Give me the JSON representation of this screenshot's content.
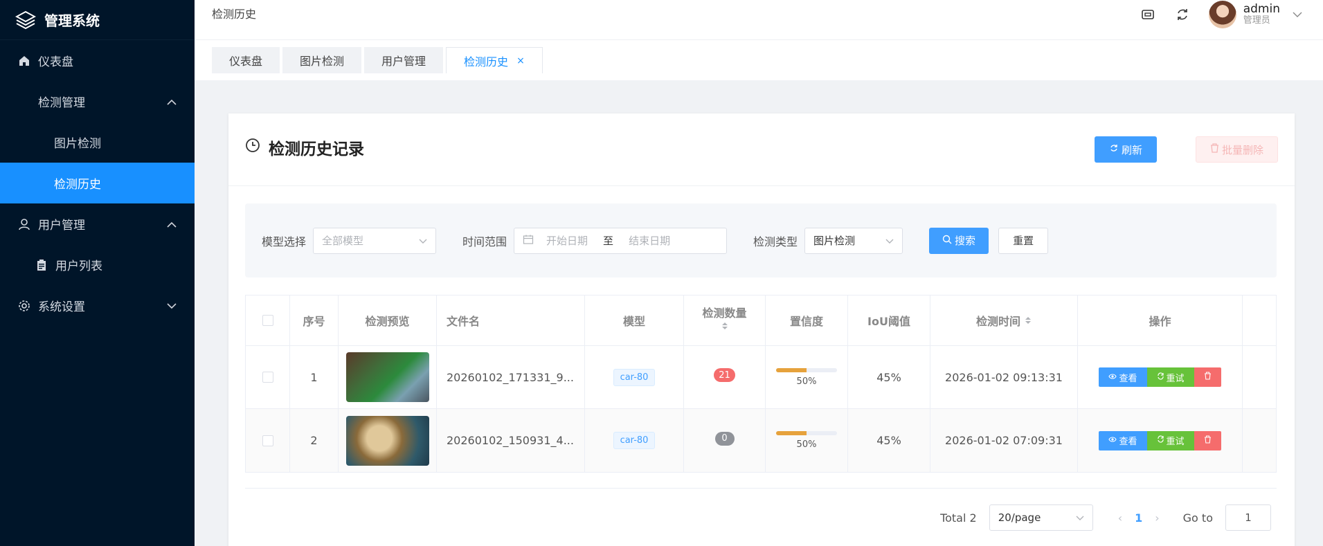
{
  "app": {
    "title": "管理系统"
  },
  "sidebar": {
    "items": [
      {
        "label": "仪表盘",
        "icon": "home-icon"
      },
      {
        "label": "检测管理",
        "icon": "",
        "expanded": true
      },
      {
        "label": "图片检测"
      },
      {
        "label": "检测历史",
        "active": true
      },
      {
        "label": "用户管理",
        "icon": "user-icon",
        "expanded": true
      },
      {
        "label": "用户列表",
        "icon": "clipboard-icon"
      },
      {
        "label": "系统设置",
        "icon": "gear-icon",
        "expanded": false
      }
    ]
  },
  "header": {
    "breadcrumb": "检测历史",
    "user": {
      "name": "admin",
      "role": "管理员"
    }
  },
  "tabs": [
    {
      "label": "仪表盘"
    },
    {
      "label": "图片检测"
    },
    {
      "label": "用户管理"
    },
    {
      "label": "检测历史",
      "active": true,
      "close": "×"
    }
  ],
  "card": {
    "title": "检测历史记录",
    "refresh_label": "刷新",
    "batch_delete_label": "批量删除"
  },
  "filter": {
    "model_label": "模型选择",
    "model_placeholder": "全部模型",
    "time_label": "时间范围",
    "start_placeholder": "开始日期",
    "range_sep": "至",
    "end_placeholder": "结束日期",
    "type_label": "检测类型",
    "type_value": "图片检测",
    "search_label": "搜索",
    "reset_label": "重置"
  },
  "table": {
    "columns": [
      "序号",
      "检测预览",
      "文件名",
      "模型",
      "检测数量",
      "置信度",
      "IoU阈值",
      "检测时间",
      "操作"
    ],
    "rows": [
      {
        "idx": "1",
        "file": "20260102_171331_9...",
        "model": "car-80",
        "count": "21",
        "conf": "50%",
        "conf_value": 0.5,
        "iou": "45%",
        "time": "2026-01-02 09:13:31"
      },
      {
        "idx": "2",
        "file": "20260102_150931_4...",
        "model": "car-80",
        "count": "0",
        "conf": "50%",
        "conf_value": 0.5,
        "iou": "45%",
        "time": "2026-01-02 07:09:31"
      }
    ],
    "actions": {
      "view": "查看",
      "retry": "重试"
    }
  },
  "pagination": {
    "total": "Total 2",
    "page_size": "20/page",
    "current": "1",
    "goto_label": "Go to",
    "goto_value": "1"
  },
  "colors": {
    "primary": "#409eff",
    "sidebar_bg": "#001529",
    "active": "#1890ff",
    "success": "#67c23a",
    "danger": "#f56c6c",
    "warning": "#e6a23c"
  }
}
